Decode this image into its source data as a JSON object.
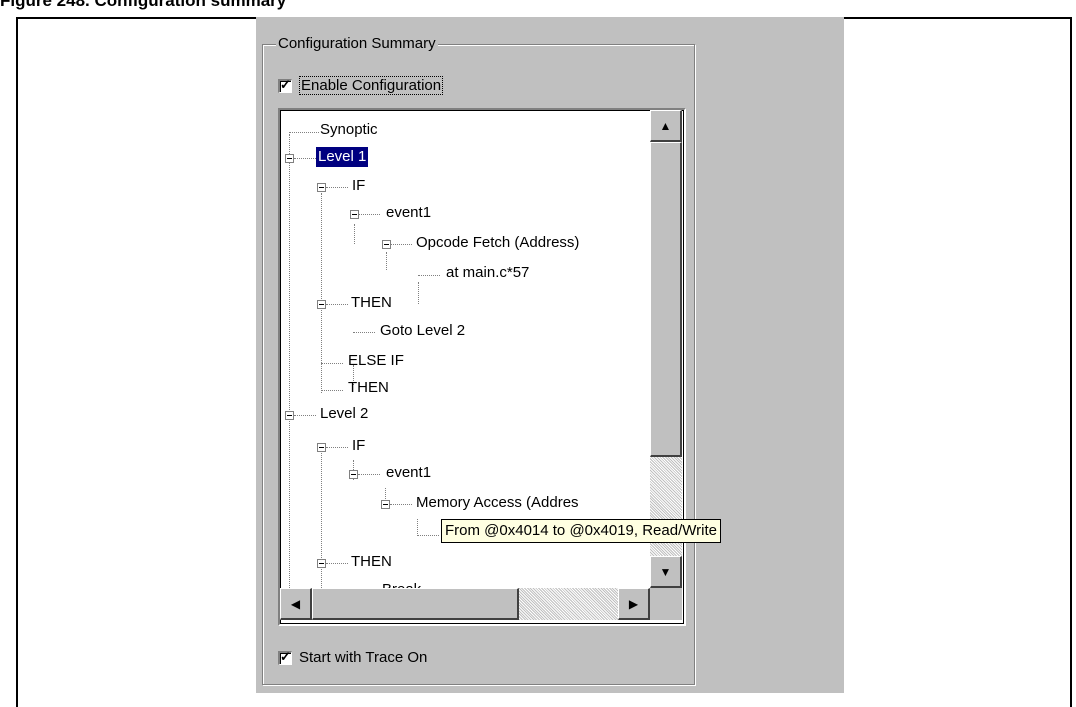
{
  "figure": {
    "title": "Figure 248. Configuration summary"
  },
  "group": {
    "legend": "Configuration Summary"
  },
  "checkboxes": {
    "enable_configuration": {
      "label": "Enable Configuration",
      "checked": true
    },
    "start_with_trace": {
      "label": "Start with Trace On",
      "checked": true
    }
  },
  "tree": {
    "nodes": [
      {
        "label": "Synoptic"
      },
      {
        "label": "Level 1",
        "selected": true
      },
      {
        "label": "IF"
      },
      {
        "label": "event1"
      },
      {
        "label": "Opcode Fetch (Address)"
      },
      {
        "label": "at main.c*57"
      },
      {
        "label": "THEN"
      },
      {
        "label": "Goto  Level 2"
      },
      {
        "label": "ELSE IF"
      },
      {
        "label": "THEN"
      },
      {
        "label": "Level 2"
      },
      {
        "label": "IF"
      },
      {
        "label": "event1"
      },
      {
        "label": "Memory Access (Addres"
      },
      {
        "label": "THEN"
      },
      {
        "label": "Break"
      }
    ],
    "tooltip": "From @0x4014 to @0x4019, Read/Write"
  },
  "scrollbars": {
    "up_arrow": "▲",
    "down_arrow": "▼",
    "left_arrow": "◀",
    "right_arrow": "▶"
  },
  "colors": {
    "selection": "#000080",
    "dialog": "#c0c0c0",
    "tooltip": "#ffffe1"
  }
}
